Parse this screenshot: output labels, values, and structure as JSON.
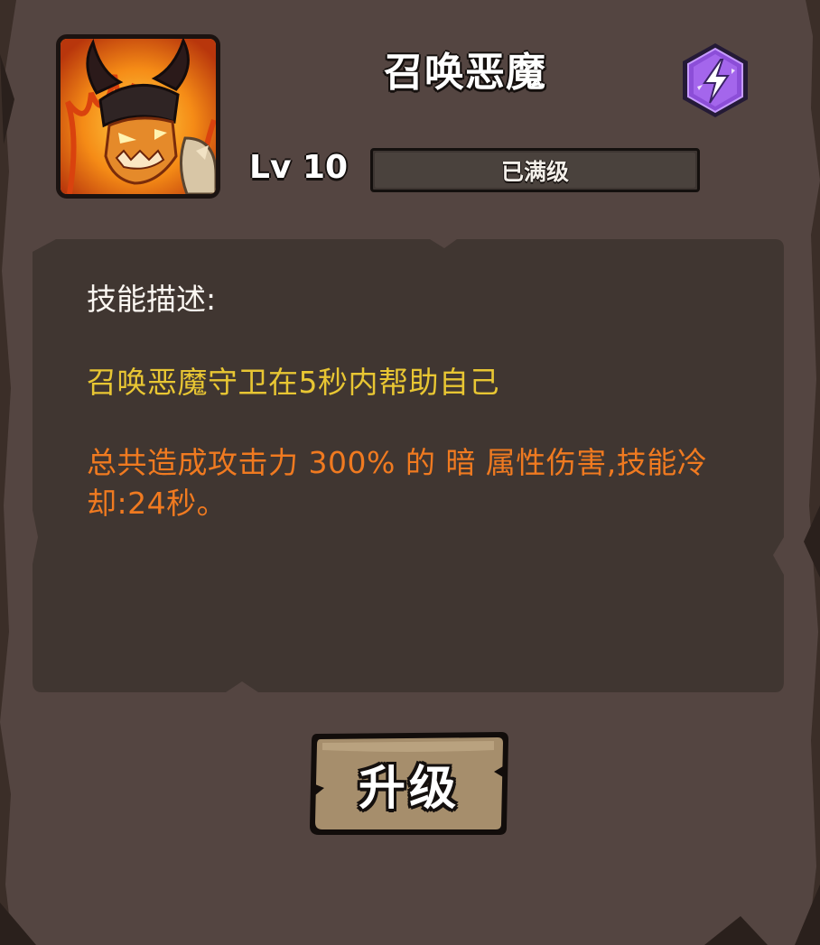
{
  "skill": {
    "name": "召唤恶魔",
    "icon": "demon-portrait-icon",
    "element_icon": "lightning-icon",
    "element_color": "#8c4ed8"
  },
  "level": {
    "label": "Lv 10",
    "status": "已满级",
    "progress": 1.0
  },
  "description": {
    "heading": "技能描述:",
    "summary": "召唤恶魔守卫在5秒内帮助自己",
    "detail": "总共造成攻击力 300% 的 暗 属性伤害,技能冷却:24秒。"
  },
  "actions": {
    "upgrade_label": "升级"
  },
  "colors": {
    "panel": "#544541",
    "panel_inner": "#403631",
    "summary_text": "#e8c633",
    "detail_text": "#f07a20",
    "button_fill": "#a68e6c"
  }
}
